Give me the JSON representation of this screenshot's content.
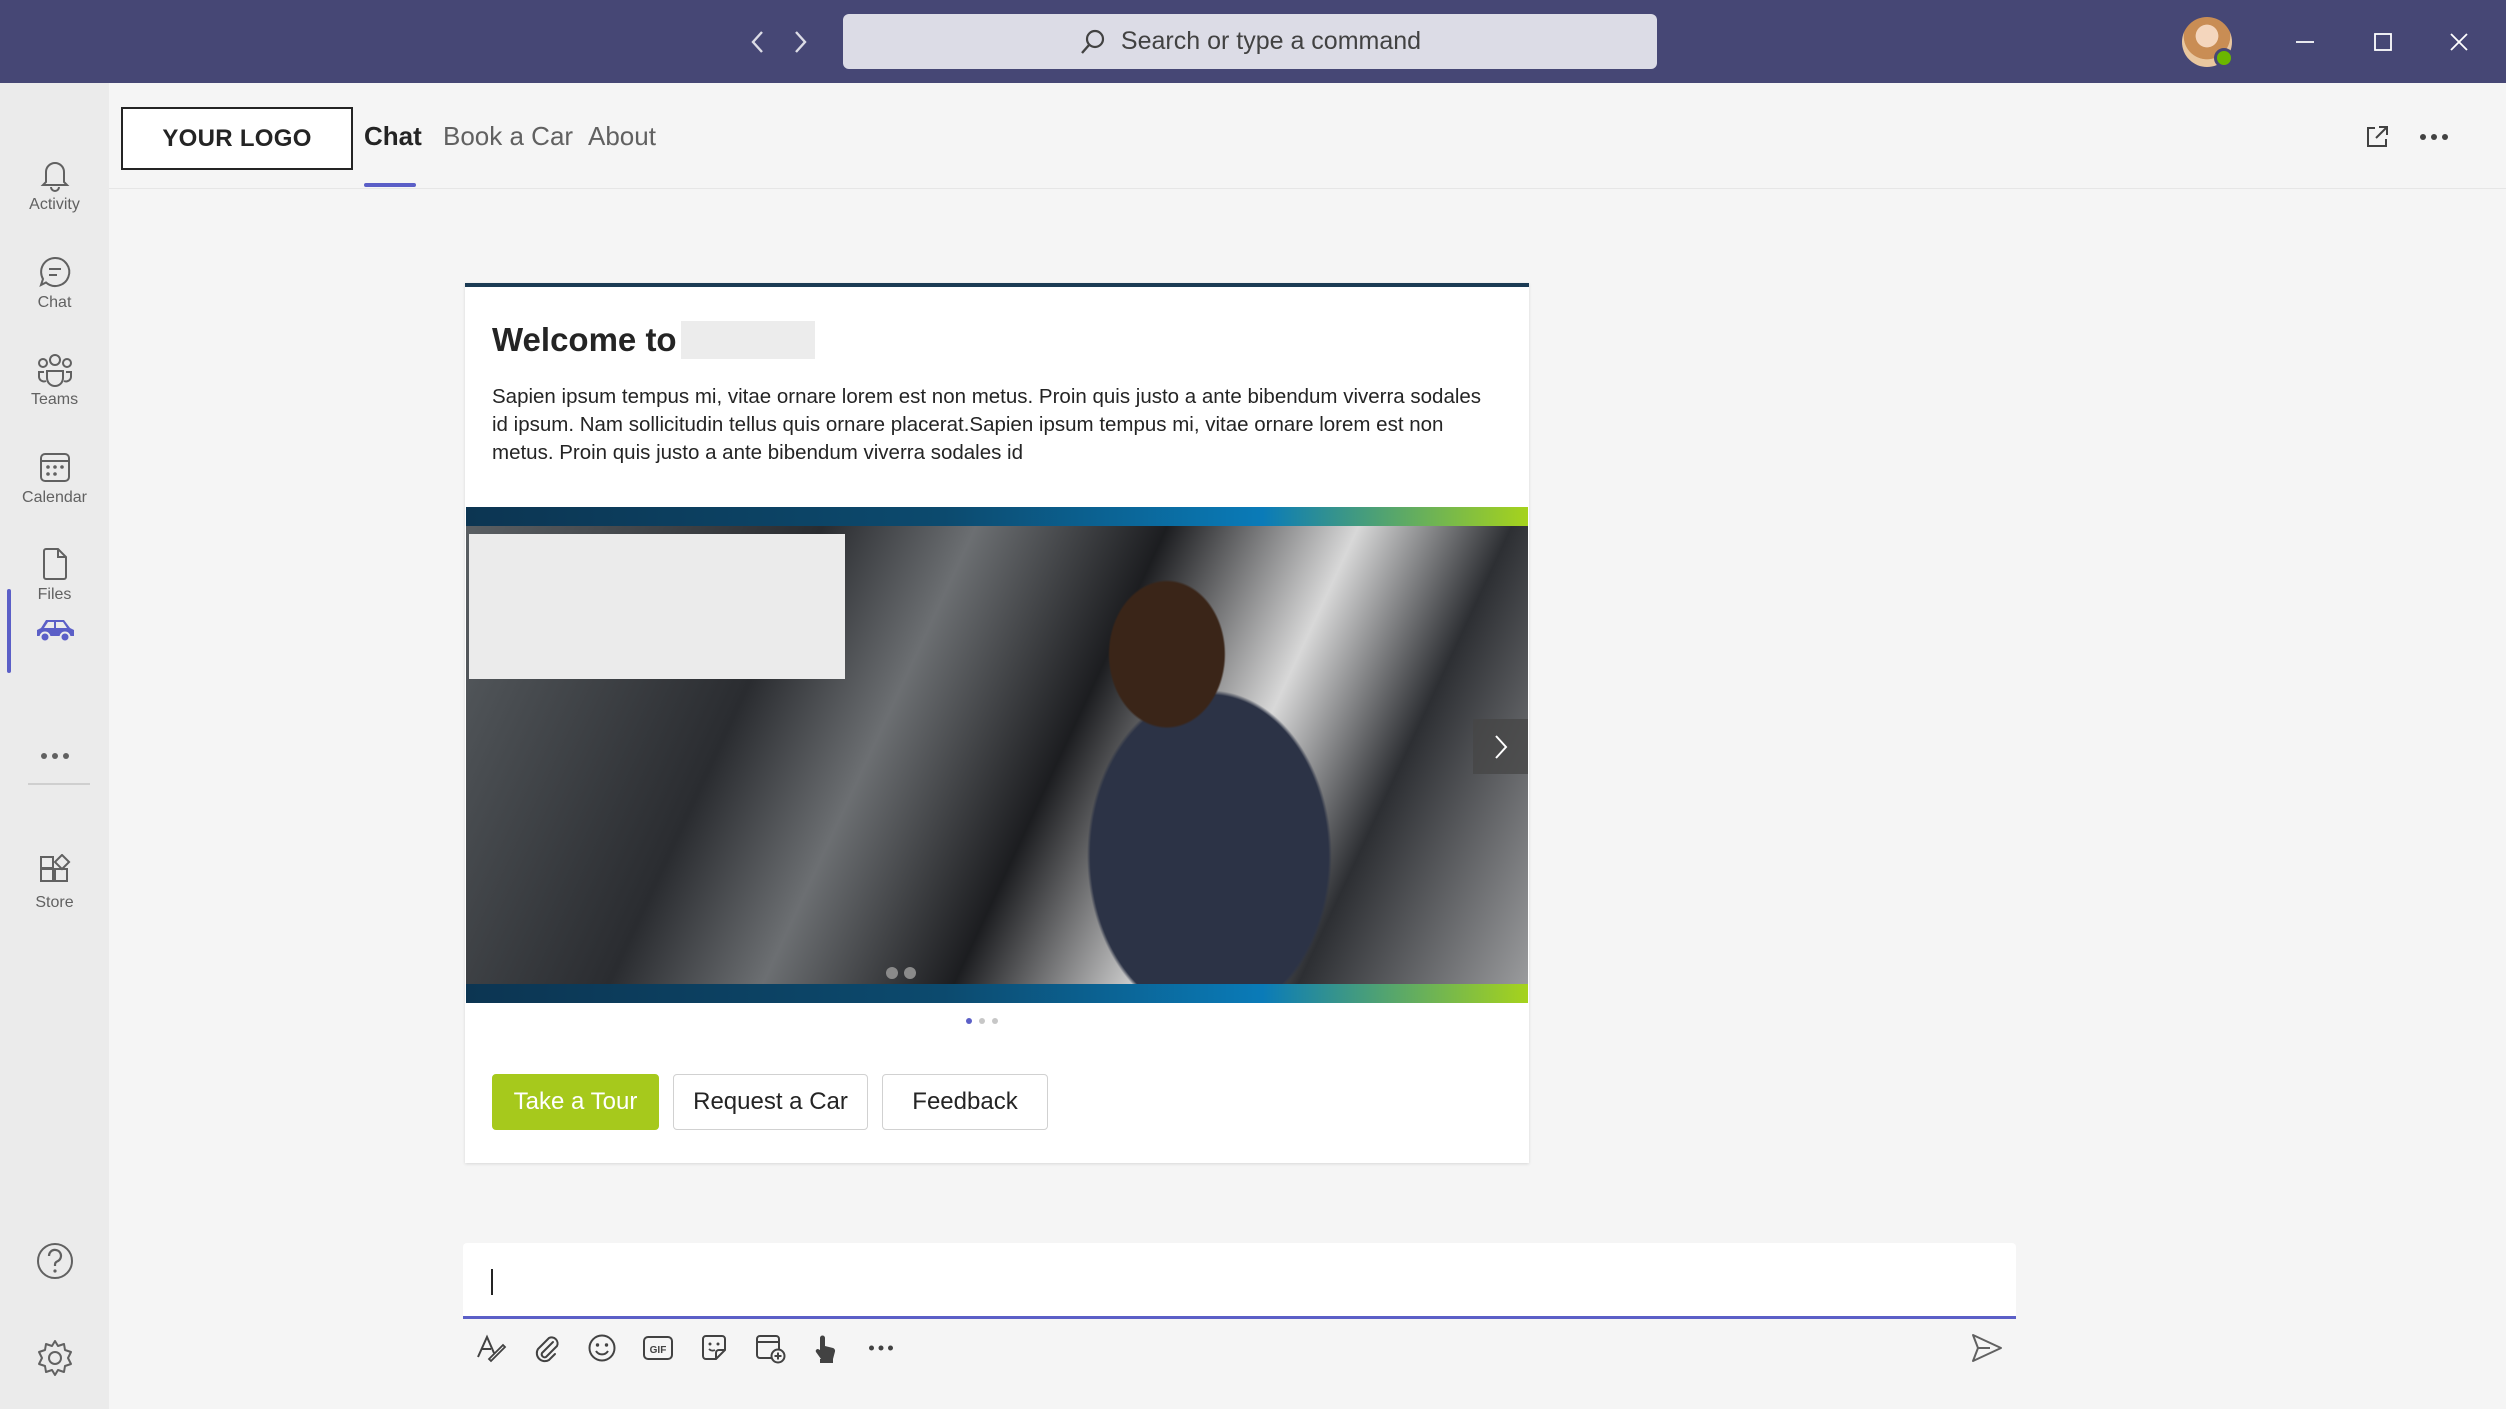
{
  "titlebar": {
    "search_placeholder": "Search or type a command",
    "accent": "#464775"
  },
  "rail": {
    "items": [
      {
        "label": "Activity",
        "icon": "bell-icon"
      },
      {
        "label": "Chat",
        "icon": "chat-icon"
      },
      {
        "label": "Teams",
        "icon": "teams-icon"
      },
      {
        "label": "Calendar",
        "icon": "calendar-icon"
      },
      {
        "label": "Files",
        "icon": "file-icon"
      },
      {
        "label": "",
        "icon": "car-icon",
        "active": true
      },
      {
        "label": "",
        "icon": "more-icon"
      },
      {
        "label": "Store",
        "icon": "store-icon"
      }
    ]
  },
  "header": {
    "logo": "YOUR LOGO",
    "tabs": [
      {
        "label": "Chat",
        "active": true
      },
      {
        "label": "Book a Car",
        "active": false
      },
      {
        "label": "About",
        "active": false
      }
    ]
  },
  "card": {
    "title": "Welcome to",
    "body": "Sapien ipsum tempus mi, vitae ornare lorem est non metus. Proin quis justo a ante bibendum viverra sodales id ipsum. Nam sollicitudin tellus quis ornare placerat.Sapien ipsum tempus mi, vitae ornare lorem est non metus. Proin quis justo a ante bibendum viverra sodales id",
    "carousel": {
      "slides": 3,
      "current": 1
    },
    "buttons": [
      {
        "label": "Take a Tour",
        "primary": true
      },
      {
        "label": "Request a Car",
        "primary": false
      },
      {
        "label": "Feedback",
        "primary": false
      }
    ],
    "accent_green": "#a6c91c"
  },
  "compose": {
    "tools": [
      "format-icon",
      "attach-icon",
      "emoji-icon",
      "gif-icon",
      "sticker-icon",
      "schedule-meeting-icon",
      "praise-icon",
      "more-icon"
    ]
  }
}
